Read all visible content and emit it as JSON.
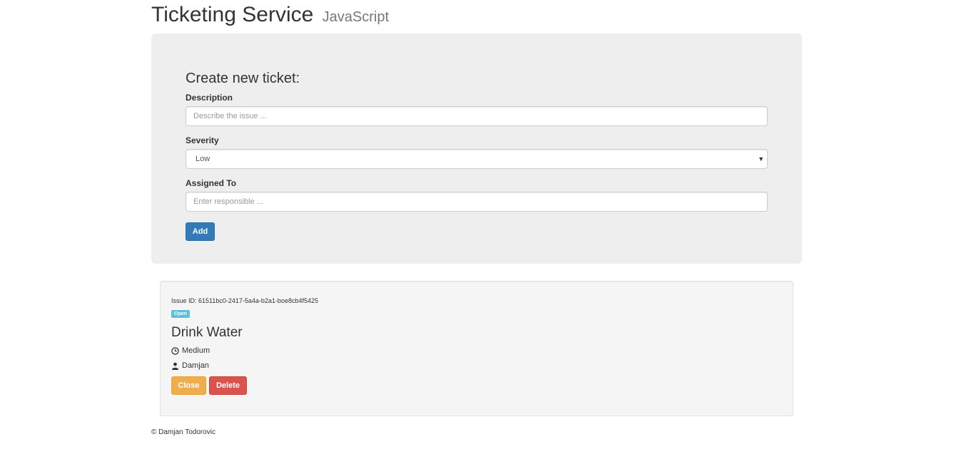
{
  "header": {
    "title": "Ticketing Service",
    "subtitle": "JavaScript"
  },
  "form": {
    "heading": "Create new ticket:",
    "description": {
      "label": "Description",
      "placeholder": "Describe the issue ..."
    },
    "severity": {
      "label": "Severity",
      "selected": "Low"
    },
    "assigned_to": {
      "label": "Assigned To",
      "placeholder": "Enter responsible ..."
    },
    "add_label": "Add"
  },
  "issues": [
    {
      "id_text": "Issue ID: 61511bc0-2417-5a4a-b2a1-boe8cb4f5425",
      "status": "Open",
      "title": "Drink Water",
      "severity": "Medium",
      "assignee": "Damjan",
      "close_label": "Close",
      "delete_label": "Delete",
      "severity_icon": "clock-icon",
      "assignee_icon": "user-icon"
    }
  ],
  "footer": {
    "text": "© Damjan Todorovic"
  },
  "colors": {
    "primary": "#337ab7",
    "warning": "#f0ad4e",
    "danger": "#d9534f",
    "info": "#5bc0de",
    "panel_bg": "#eeeeee"
  }
}
